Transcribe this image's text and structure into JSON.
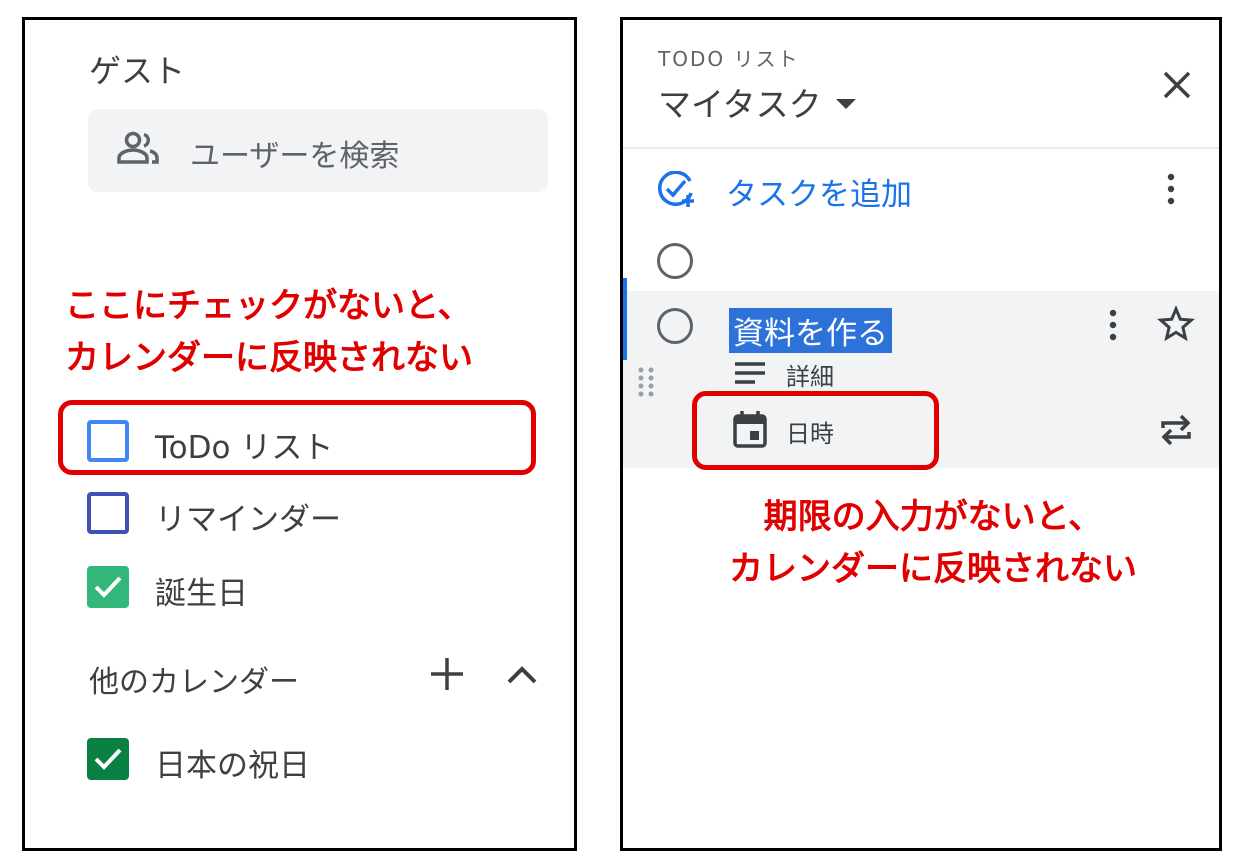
{
  "left_panel": {
    "user_label": "ゲスト",
    "search_placeholder": "ユーザーを検索",
    "annotation_line1": "ここにチェックがないと、",
    "annotation_line2": "カレンダーに反映されない",
    "my_calendars": [
      {
        "label": "ToDo リスト",
        "checked": false,
        "color": "#4285f4"
      },
      {
        "label": "リマインダー",
        "checked": false,
        "color": "#3f51b5"
      },
      {
        "label": "誕生日",
        "checked": true,
        "color": "#33b679"
      }
    ],
    "other_calendars_label": "他のカレンダー",
    "other_calendars": [
      {
        "label": "日本の祝日",
        "checked": true,
        "color": "#0b8043"
      }
    ]
  },
  "right_panel": {
    "list_eyebrow": "TODO リスト",
    "list_title": "マイタスク",
    "add_task_label": "タスクを追加",
    "tasks": [
      {
        "title": ""
      },
      {
        "title": "資料を作る",
        "selected": true
      }
    ],
    "details_label": "詳細",
    "date_label": "日時",
    "annotation_line1": "期限の入力がないと、",
    "annotation_line2": "カレンダーに反映されない"
  },
  "colors": {
    "annotation_red": "#e00000",
    "accent_blue": "#1a73e8",
    "selection_blue": "#2d72d9"
  },
  "icons": [
    "people-icon",
    "plus-icon",
    "chevron-up-icon",
    "close-icon",
    "add-task-icon",
    "more-vert-icon",
    "star-icon",
    "drag-handle-icon",
    "details-icon",
    "calendar-icon",
    "repeat-icon",
    "check-icon"
  ]
}
